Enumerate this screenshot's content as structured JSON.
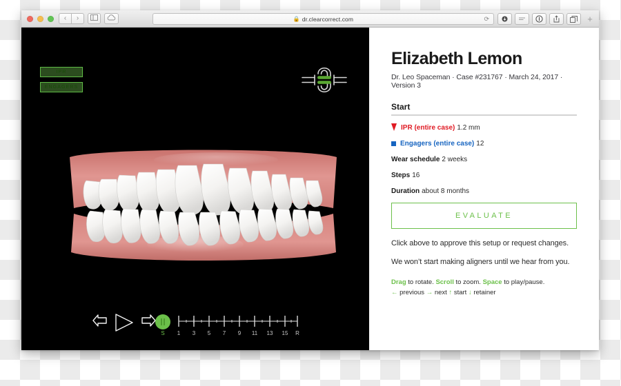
{
  "browser": {
    "url": "dr.clearcorrect.com",
    "lock_icon": "lock-icon",
    "reload_icon": "reload-icon",
    "back_icon": "‹",
    "forward_icon": "›",
    "sidebar_icon": "sidebar-icon",
    "cloud_icon": "cloud-icon",
    "new_tab_label": "+",
    "right_icons": [
      "download-icon",
      "reader-icon",
      "info-icon",
      "share-icon",
      "tabs-icon"
    ]
  },
  "viewer": {
    "layers": [
      {
        "label": "IPR",
        "name": "ipr"
      },
      {
        "label": "ENGAGERS",
        "name": "engagers"
      }
    ],
    "playback": {
      "prev_label": "previous-step",
      "play_label": "play",
      "next_label": "next-step",
      "position_label": "S"
    },
    "timeline": {
      "labels": [
        "S",
        "1",
        "3",
        "5",
        "7",
        "9",
        "11",
        "13",
        "15",
        "R"
      ],
      "accent_index": 0,
      "major_ticks": 9,
      "minor_ticks": 8
    }
  },
  "info": {
    "patient_name": "Elizabeth Lemon",
    "case_meta": "Dr. Leo Spaceman · Case #231767 · March 24, 2017 · Version 3",
    "section_title": "Start",
    "stats": [
      {
        "marker": "triangle",
        "label": "IPR (entire case)",
        "value": "1.2 mm",
        "color": "#e01b24"
      },
      {
        "marker": "square",
        "label": "Engagers (entire case)",
        "value": "12",
        "color": "#1664c0"
      },
      {
        "marker": "none",
        "label": "Wear schedule",
        "value": "2 weeks",
        "color": "#1a1a1a"
      },
      {
        "marker": "none",
        "label": "Steps",
        "value": "16",
        "color": "#1a1a1a"
      },
      {
        "marker": "none",
        "label": "Duration",
        "value": "about 8 months",
        "color": "#1a1a1a"
      }
    ],
    "evaluate_label": "EVALUATE",
    "body_line_1": "Click above to approve this setup or request changes.",
    "body_line_2": "We won’t start making aligners until we hear from you.",
    "hints": {
      "drag": "Drag",
      "drag_rest": " to rotate. ",
      "scroll": "Scroll",
      "scroll_rest": " to zoom. ",
      "space": "Space",
      "space_rest": " to play/pause.",
      "line2_prev_arrow": "←",
      "line2_prev": " previous ",
      "line2_next_arrow": "→",
      "line2_next": " next ",
      "line2_start_arrow": "↑",
      "line2_start": " start ",
      "line2_retainer_arrow": "↓",
      "line2_retainer": " retainer"
    }
  },
  "colors": {
    "accent_green": "#6cc04a",
    "ipr_red": "#e01b24",
    "engager_blue": "#1664c0",
    "gum_pink": "#d98a85",
    "tooth_white": "#f2f1ef"
  }
}
